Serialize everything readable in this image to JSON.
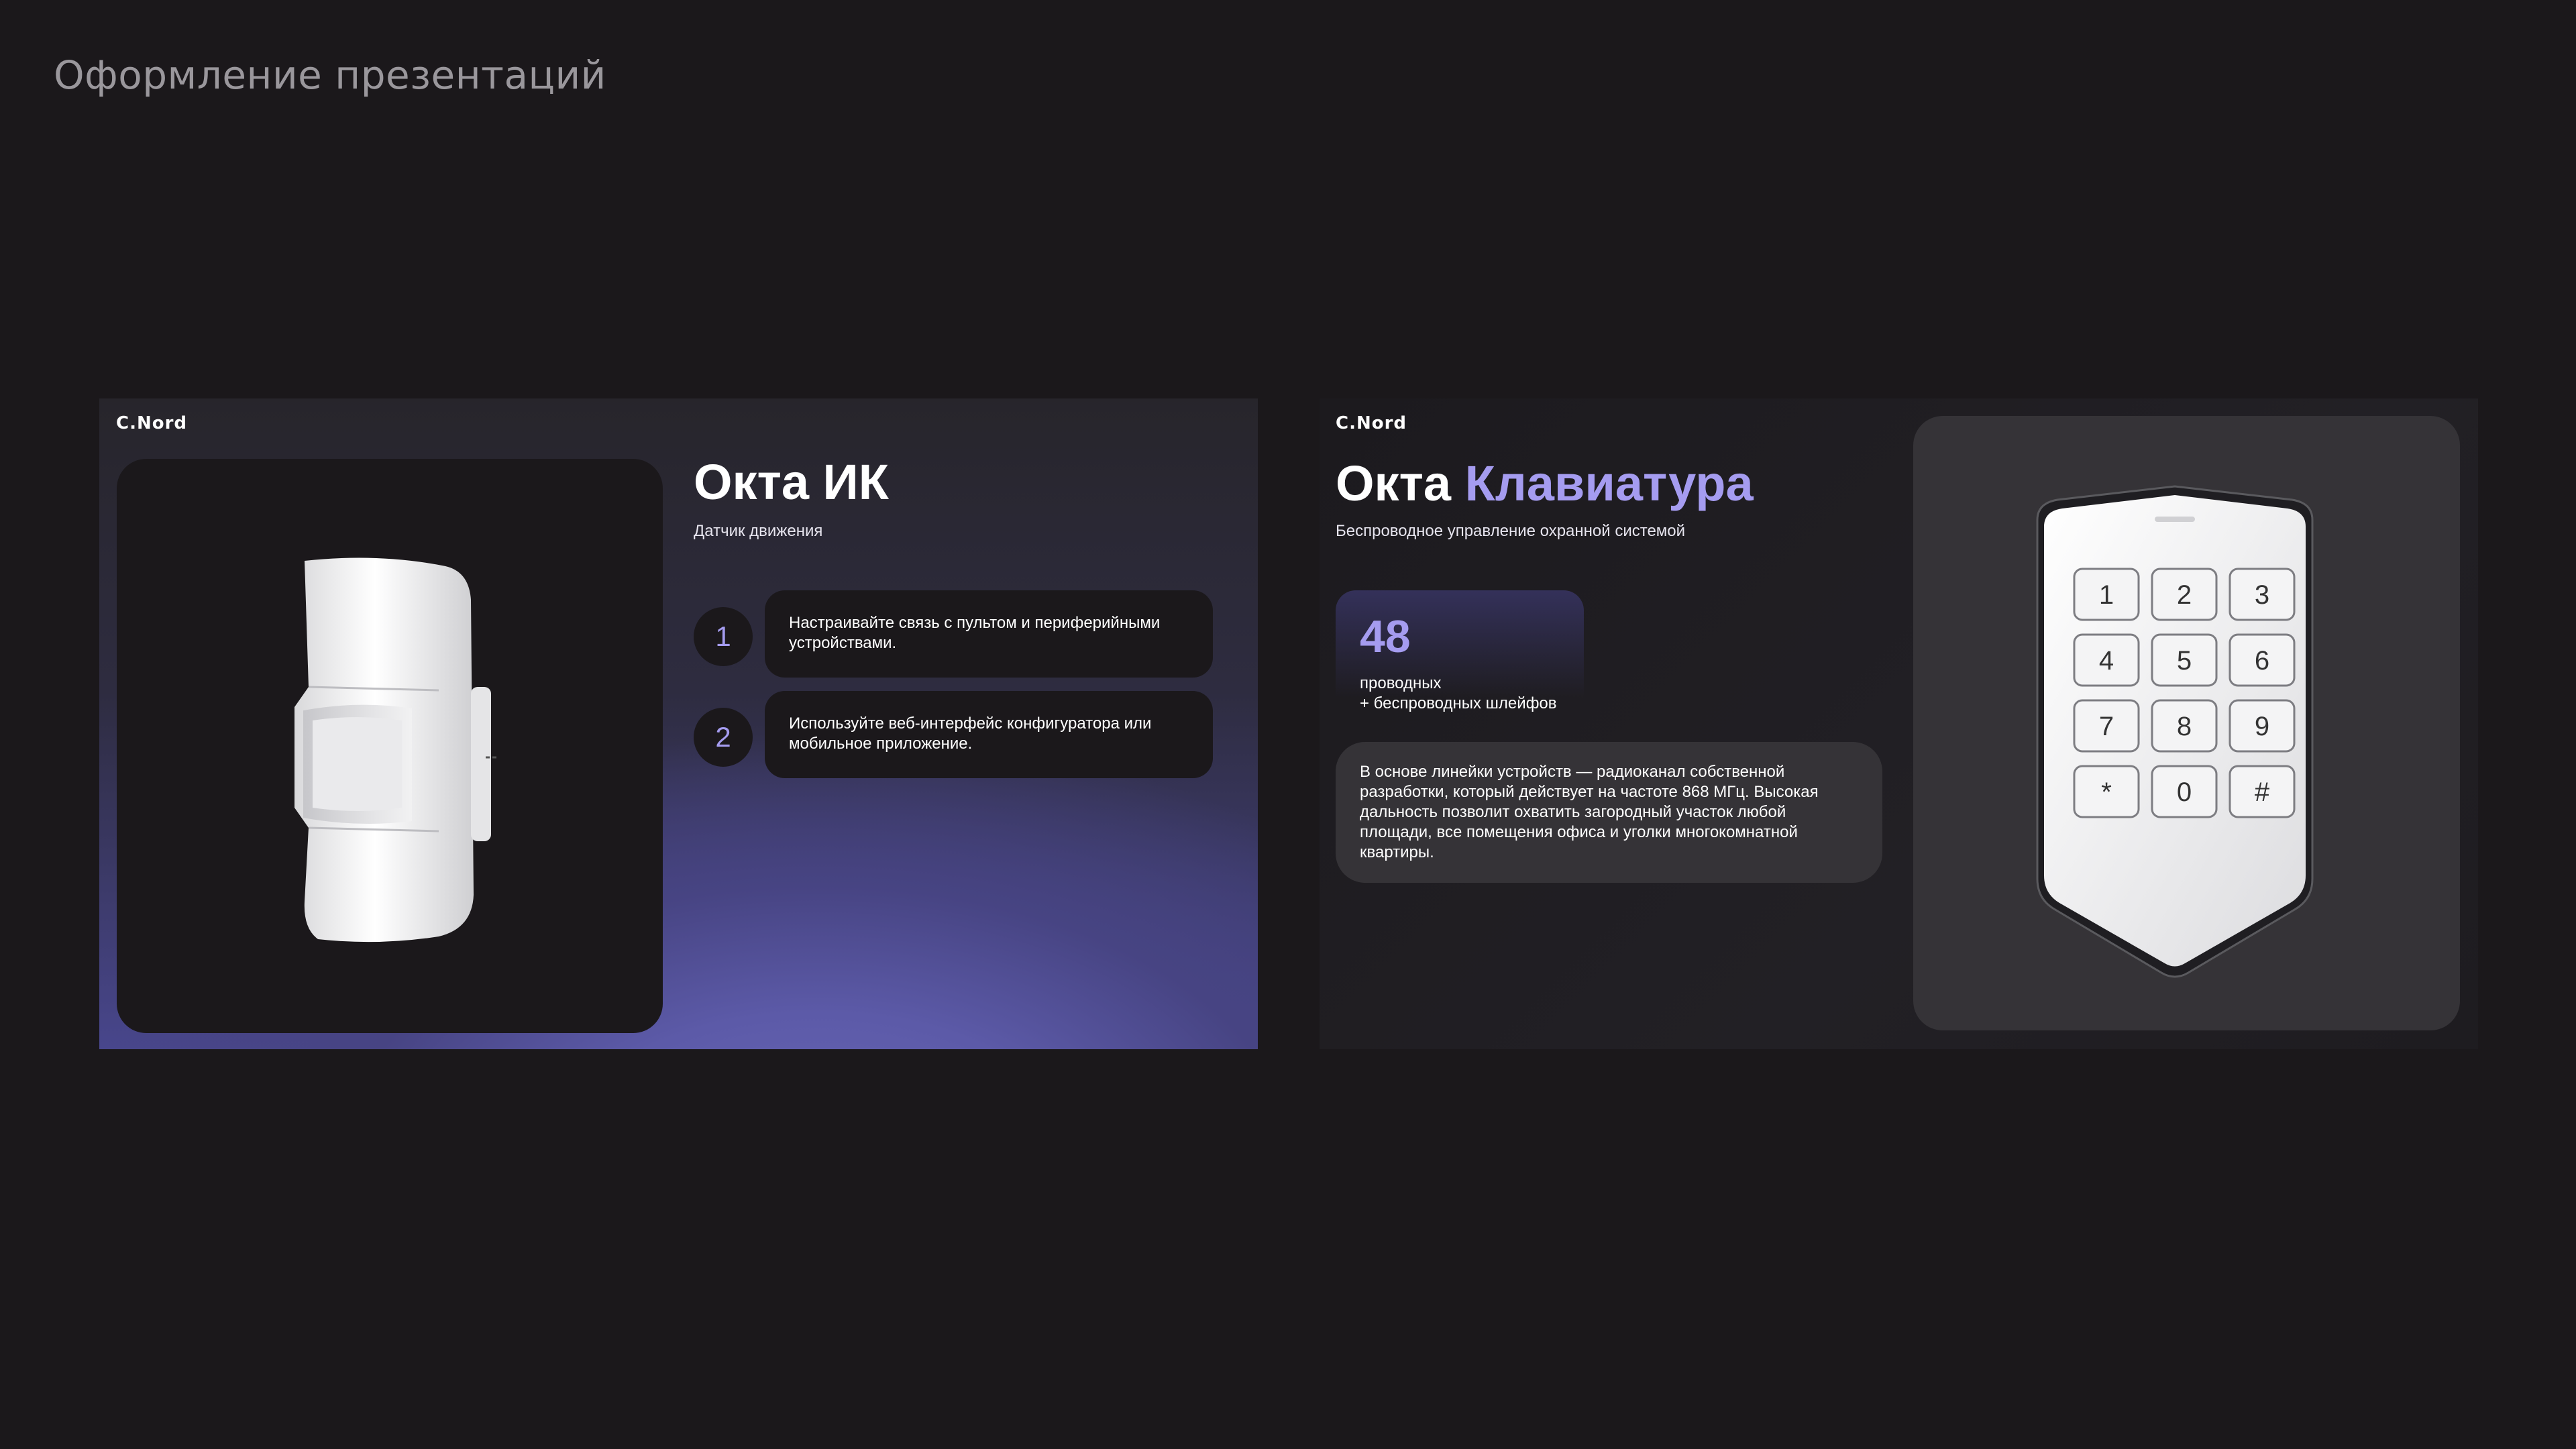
{
  "page": {
    "title": "Оформление презентаций"
  },
  "slides": [
    {
      "logo": "C.Nord",
      "title": "Окта ИК",
      "subtitle": "Датчик движения",
      "steps": [
        {
          "num": "1",
          "text": "Настраивайте связь с пультом и периферийными устройствами."
        },
        {
          "num": "2",
          "text": "Используйте веб-интерфейс конфигуратора или мобильное приложение."
        }
      ],
      "image": "motion-sensor"
    },
    {
      "logo": "C.Nord",
      "title_part1": "Окта",
      "title_part2": "Клавиатура",
      "subtitle": "Беспроводное управление охранной системой",
      "stat": {
        "value": "48",
        "label": "проводных\n+ беспроводных шлейфов"
      },
      "description": "В основе линейки устройств — радиоканал собственной разработки, который действует на частоте 868 МГц.  Высокая дальность позволит охватить загородный участок любой площади, все помещения офиса и уголки многокомнатной квартиры.",
      "keypad": {
        "keys": [
          "1",
          "2",
          "3",
          "4",
          "5",
          "6",
          "7",
          "8",
          "9",
          "*",
          "0",
          "#"
        ]
      },
      "image": "keypad"
    }
  ],
  "colors": {
    "accent": "#a59cf0",
    "background": "#1b181b",
    "card": "#353337"
  }
}
